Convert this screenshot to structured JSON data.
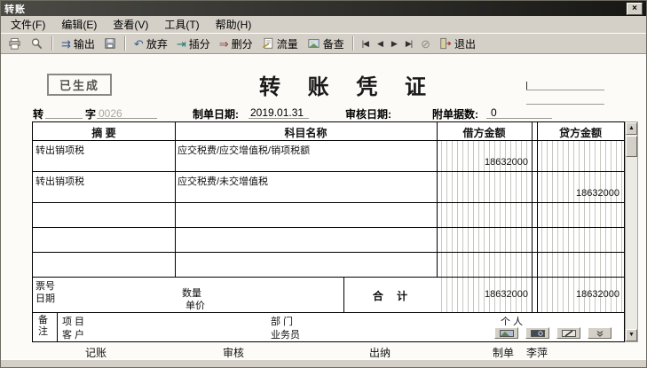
{
  "window": {
    "title": "转账"
  },
  "menu": {
    "items": [
      "文件(F)",
      "编辑(E)",
      "查看(V)",
      "工具(T)",
      "帮助(H)"
    ]
  },
  "toolbar": {
    "output": "输出",
    "discard": "放弃",
    "insert": "插分",
    "delete_entry": "删分",
    "flow": "流量",
    "reference": "备查",
    "exit": "退出"
  },
  "icons": {
    "close": "×",
    "output_glyph": "⇉",
    "discard_glyph": "↶",
    "insert_glyph": "⇥",
    "delete_glyph": "⇒",
    "approve_glyph": "⊘",
    "nav_first": "|◀",
    "nav_prev": "◀",
    "nav_next": "▶",
    "nav_last": "▶|",
    "scroll_up": "▲",
    "scroll_down": "▼"
  },
  "voucher": {
    "stamp": "已生成",
    "title": "转 账 凭 证",
    "type_label": "转",
    "word_label": "字",
    "number": "0026",
    "made_label": "制单日期:",
    "made_date": "2019.01.31",
    "audit_label": "审核日期:",
    "attach_label": "附单据数:",
    "attach_count": "0"
  },
  "table": {
    "headers": [
      "摘 要",
      "科目名称",
      "借方金额",
      "贷方金额"
    ],
    "rows": [
      {
        "summary": "转出销项税",
        "account": "应交税费/应交增值税/销项税额",
        "debit": "18632000",
        "credit": ""
      },
      {
        "summary": "转出销项税",
        "account": "应交税费/未交增值税",
        "debit": "",
        "credit": "18632000"
      },
      {
        "summary": "",
        "account": "",
        "debit": "",
        "credit": ""
      },
      {
        "summary": "",
        "account": "",
        "debit": "",
        "credit": ""
      },
      {
        "summary": "",
        "account": "",
        "debit": "",
        "credit": ""
      }
    ],
    "total": {
      "ticket_label": "票号",
      "date_label": "日期",
      "qty_label": "数量",
      "price_label": "单价",
      "label": "合 计",
      "debit": "18632000",
      "credit": "18632000"
    },
    "footer": {
      "remark": "备注",
      "project": "项 目",
      "customer": "客 户",
      "dept": "部 门",
      "salesman": "业务员",
      "person": "个 人"
    }
  },
  "signatures": {
    "book": "记账",
    "audit": "审核",
    "cashier": "出纳",
    "maker": "制单",
    "maker_name": "李萍"
  },
  "colors": {
    "titlebar_dark": "#171715",
    "window_bg": "#d4d0c8",
    "pinstripe": "#c6c6c0",
    "muted_number": "#a9a9a1"
  }
}
